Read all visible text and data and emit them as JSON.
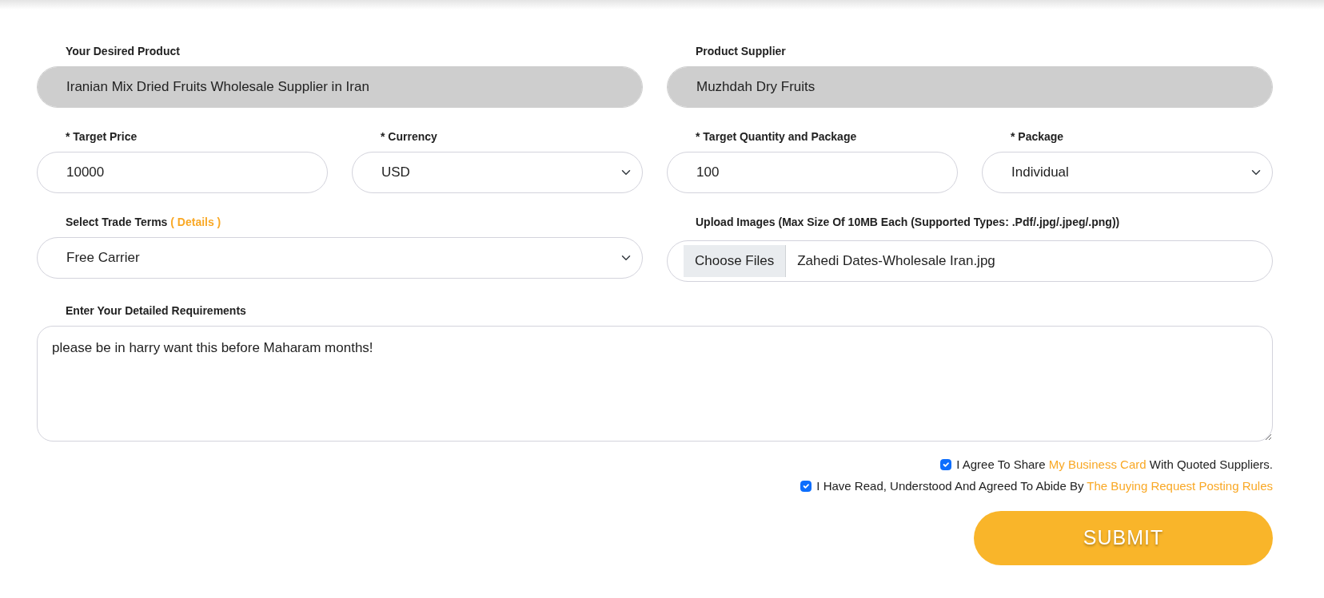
{
  "rows": [
    [
      {
        "kind": "text",
        "label": "Your Desired Product",
        "value": "Iranian Mix Dried Fruits Wholesale Supplier in Iran",
        "disabled": true
      },
      {
        "kind": "text",
        "label": "Product Supplier",
        "value": "Muzhdah Dry Fruits",
        "disabled": true
      }
    ],
    [
      {
        "kind": "text",
        "label": "* Target Price",
        "value": "10000",
        "disabled": false
      },
      {
        "kind": "select",
        "label": "* Currency",
        "value": "USD",
        "disabled": false
      },
      {
        "kind": "text",
        "label": "* Target Quantity and Package",
        "value": "100",
        "disabled": false
      },
      {
        "kind": "select",
        "label": "* Package",
        "value": "Individual",
        "disabled": false
      }
    ],
    [
      {
        "kind": "select",
        "label": "Select Trade Terms",
        "label_link": "( Details )",
        "value": "Free Carrier",
        "disabled": false
      },
      {
        "kind": "file",
        "label": "Upload Images (Max Size Of 10MB Each (Supported Types: .Pdf/.jpg/.jpeg/.png))",
        "button": "Choose Files",
        "value": "Zahedi Dates-Wholesale Iran.jpg",
        "disabled": false
      }
    ],
    [
      {
        "kind": "textarea",
        "label": "Enter Your Detailed Requirements",
        "value": "please be in harry want this before Maharam months!",
        "disabled": false
      }
    ]
  ],
  "agreements": [
    {
      "checked": true,
      "before": "I Agree To Share ",
      "link": "My Business Card",
      "after": " With Quoted Suppliers."
    },
    {
      "checked": true,
      "before": "I Have Read, Understood And Agreed To Abide By ",
      "link": "The Buying Request Posting Rules"
    }
  ],
  "submit": "SUBMIT"
}
